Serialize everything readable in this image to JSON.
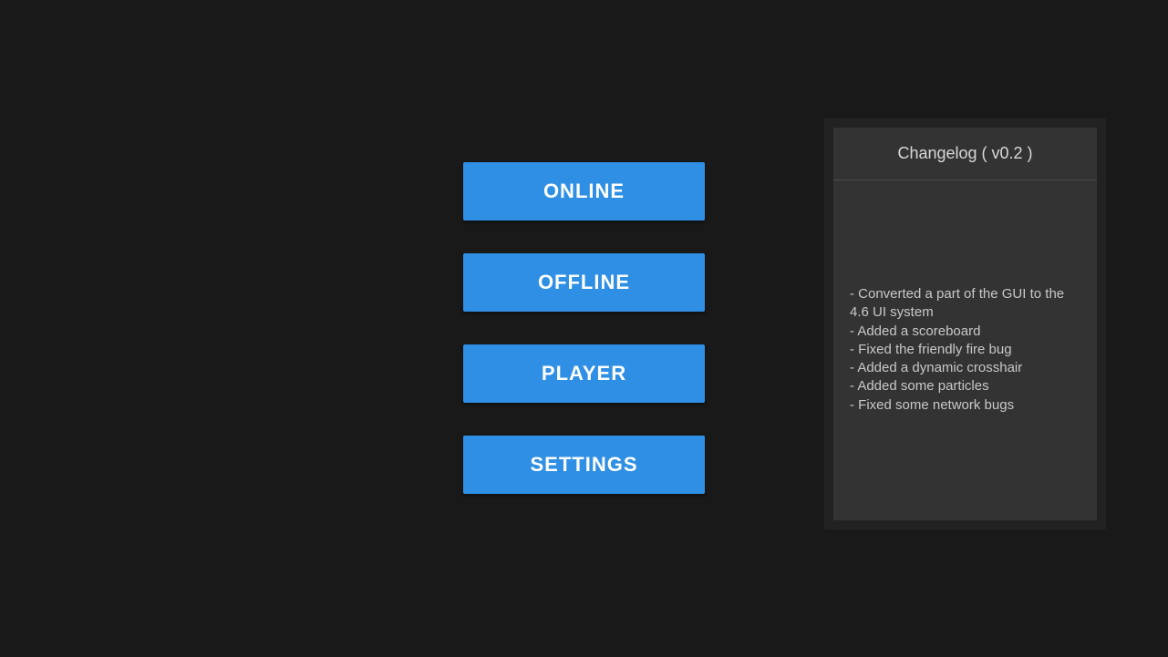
{
  "menu": {
    "buttons": [
      {
        "label": "ONLINE"
      },
      {
        "label": "OFFLINE"
      },
      {
        "label": "PLAYER"
      },
      {
        "label": "SETTINGS"
      }
    ]
  },
  "changelog": {
    "title": "Changelog ( v0.2 )",
    "body": "- Converted a part of the GUI to the 4.6 UI system\n- Added a scoreboard\n- Fixed the friendly fire bug\n- Added a dynamic crosshair\n- Added some particles\n- Fixed some network bugs"
  }
}
